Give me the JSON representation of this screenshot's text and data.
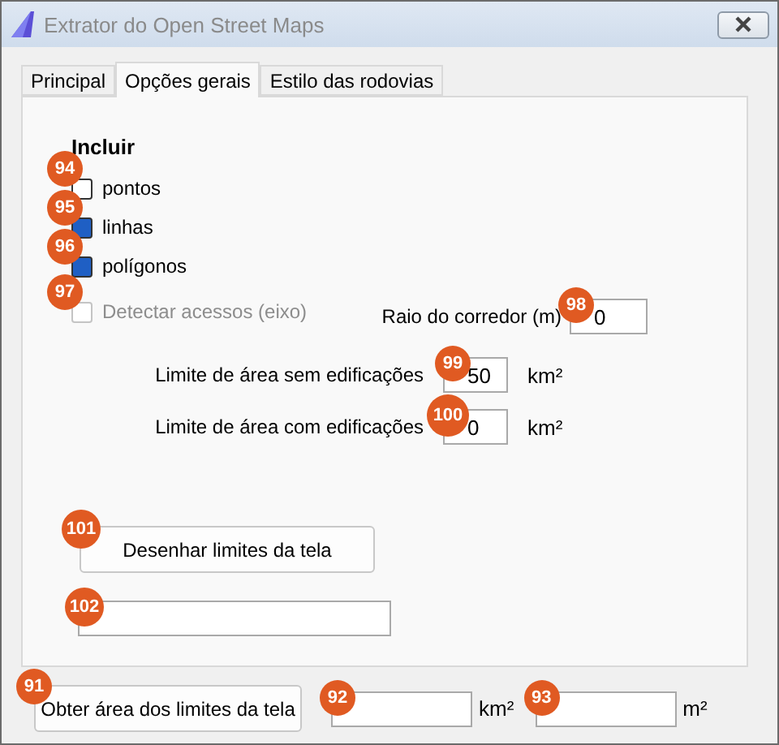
{
  "window": {
    "title": "Extrator do Open Street Maps"
  },
  "tabs": [
    {
      "label": "Principal",
      "selected": false
    },
    {
      "label": "Opções gerais",
      "selected": true
    },
    {
      "label": "Estilo das rodovias",
      "selected": false
    }
  ],
  "include": {
    "heading": "Incluir",
    "options": [
      {
        "label": "pontos",
        "checked": false,
        "disabled": false,
        "badge": "94"
      },
      {
        "label": "linhas",
        "checked": true,
        "disabled": false,
        "badge": "95"
      },
      {
        "label": "polígonos",
        "checked": true,
        "disabled": false,
        "badge": "96"
      },
      {
        "label": "Detectar acessos (eixo)",
        "checked": false,
        "disabled": true,
        "badge": "97"
      }
    ]
  },
  "corridor": {
    "label": "Raio do corredor (m)",
    "value": "0",
    "badge": "98"
  },
  "area_limits": [
    {
      "label": "Limite de área sem edificações",
      "value": "50",
      "unit": "km²",
      "badge": "99"
    },
    {
      "label": "Limite de área com edificações",
      "value": "0",
      "unit": "km²",
      "badge": "100"
    }
  ],
  "draw_button": {
    "label": "Desenhar limites da tela",
    "badge": "101"
  },
  "draw_field": {
    "badge": "102"
  },
  "bottom": {
    "button": {
      "label": "Obter área dos limites da tela",
      "badge": "91"
    },
    "fields": [
      {
        "unit": "km²",
        "badge": "92"
      },
      {
        "unit": "m²",
        "badge": "93"
      }
    ]
  }
}
